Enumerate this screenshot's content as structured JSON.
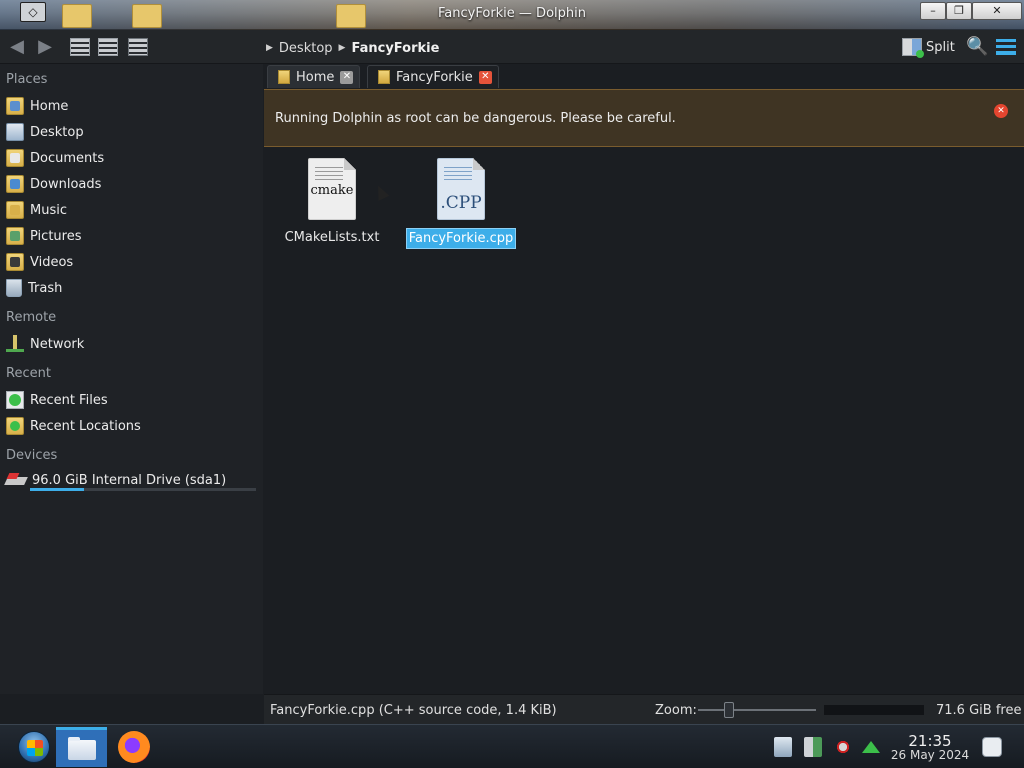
{
  "window": {
    "title": "FancyForkie — Dolphin",
    "app_menu_glyph": "◇",
    "minimize_glyph": "–",
    "maximize_glyph": "❐",
    "close_glyph": "✕"
  },
  "toolbar": {
    "back_glyph": "◀",
    "forward_glyph": "▶",
    "breadcrumb": [
      "Desktop",
      "FancyForkie"
    ],
    "split_label": "Split",
    "search_glyph": "🔍"
  },
  "sidebar": {
    "places_title": "Places",
    "places": [
      {
        "label": "Home",
        "icon": "home-folder-icon"
      },
      {
        "label": "Desktop",
        "icon": "desktop-icon"
      },
      {
        "label": "Documents",
        "icon": "documents-folder-icon"
      },
      {
        "label": "Downloads",
        "icon": "downloads-folder-icon"
      },
      {
        "label": "Music",
        "icon": "music-folder-icon"
      },
      {
        "label": "Pictures",
        "icon": "pictures-folder-icon"
      },
      {
        "label": "Videos",
        "icon": "videos-folder-icon"
      },
      {
        "label": "Trash",
        "icon": "trash-icon"
      }
    ],
    "remote_title": "Remote",
    "remote": [
      {
        "label": "Network",
        "icon": "network-icon"
      }
    ],
    "recent_title": "Recent",
    "recent": [
      {
        "label": "Recent Files",
        "icon": "recent-files-icon"
      },
      {
        "label": "Recent Locations",
        "icon": "recent-locations-icon"
      }
    ],
    "devices_title": "Devices",
    "devices": [
      {
        "label": "96.0 GiB Internal Drive (sda1)",
        "icon": "drive-icon",
        "usage_fraction": 0.24
      }
    ]
  },
  "tabs": [
    {
      "label": "Home",
      "active": false
    },
    {
      "label": "FancyForkie",
      "active": true
    }
  ],
  "tab_close_glyph": "✕",
  "banner": {
    "message": "Running Dolphin as root can be dangerous. Please be careful.",
    "close_glyph": "✕",
    "colors": {
      "background": "#3f3423",
      "border": "#7a5c2e"
    }
  },
  "files": [
    {
      "name": "CMakeLists.txt",
      "icon_text": "cmake",
      "selected": false
    },
    {
      "name": "FancyForkie.cpp",
      "icon_text": ".CPP",
      "selected": true
    }
  ],
  "statusbar": {
    "selection_info": "FancyForkie.cpp (C++ source code, 1.4 KiB)",
    "zoom_label": "Zoom:",
    "free_space": "71.6 GiB free"
  },
  "taskbar": {
    "clock_time": "21:35",
    "clock_date": "26 May 2024"
  },
  "colors": {
    "accent": "#3daee9",
    "selection": "#3daee9",
    "background": "#1b1e22",
    "sidebar": "#1f2226"
  }
}
